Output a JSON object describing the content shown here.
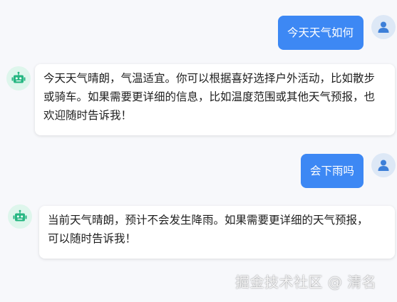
{
  "messages": [
    {
      "role": "user",
      "avatar_icon": "user-icon",
      "text": "今天天气如何"
    },
    {
      "role": "bot",
      "avatar_icon": "robot-icon",
      "lines": [
        "今天天气晴朗，气温适宜。你可以根据喜好选择户外活动，比如散步",
        "或骑车。如果需要更详细的信息，比如温度范围或其他天气预报，也",
        "欢迎随时告诉我！"
      ]
    },
    {
      "role": "user",
      "avatar_icon": "user-icon",
      "text": "会下雨吗"
    },
    {
      "role": "bot",
      "avatar_icon": "robot-icon",
      "lines": [
        "当前天气晴朗，预计不会发生降雨。如果需要更详细的天气预报，",
        "可以随时告诉我！"
      ]
    }
  ],
  "watermark": "掘金技术社区 @ 清名",
  "colors": {
    "user_bubble": "#3d88f4",
    "user_avatar_bg": "#dde8f6",
    "user_icon": "#3d7fd8",
    "bot_avatar_bg": "#def6ec",
    "bot_icon": "#27b782",
    "page_bg": "#f7f8fb"
  }
}
